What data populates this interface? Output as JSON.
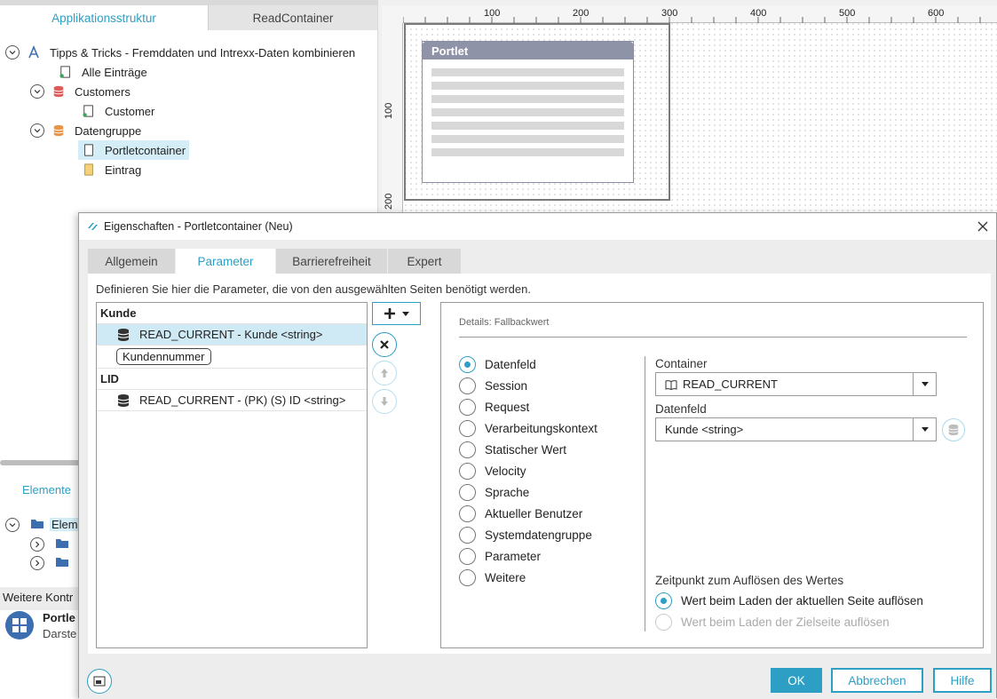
{
  "workspace": {
    "tabs": [
      "Applikationsstruktur",
      "ReadContainer"
    ],
    "tree": [
      {
        "label": "Tipps & Tricks - Fremddaten und Intrexx-Daten kombinieren"
      },
      {
        "label": "Alle Einträge"
      },
      {
        "label": "Customers"
      },
      {
        "label": "Customer"
      },
      {
        "label": "Datengruppe"
      },
      {
        "label": "Portletcontainer"
      },
      {
        "label": "Eintrag"
      }
    ],
    "ruler_top": [
      "100",
      "200",
      "300",
      "400",
      "500",
      "600"
    ],
    "ruler_left": [
      "100",
      "200"
    ],
    "portlet_title": "Portlet",
    "lower": {
      "elements_tab": "Elemente",
      "element_row": "Elem",
      "weitere": "Weitere Kontr",
      "portlet_name": "Portle",
      "portlet_desc": "Darste"
    }
  },
  "dialog": {
    "title": "Eigenschaften - Portletcontainer (Neu)",
    "tabs": [
      "Allgemein",
      "Parameter",
      "Barrierefreiheit",
      "Expert"
    ],
    "description": "Definieren Sie hier die Parameter, die von den ausgewählten Seiten benötigt werden.",
    "params": {
      "group1": "Kunde",
      "item1": "READ_CURRENT - Kunde <string>",
      "pill": "Kundennummer",
      "group2": "LID",
      "item2": "READ_CURRENT - (PK) (S) ID <string>"
    },
    "details": {
      "header": "Details: Fallbackwert",
      "options": [
        "Datenfeld",
        "Session",
        "Request",
        "Verarbeitungskontext",
        "Statischer Wert",
        "Velocity",
        "Sprache",
        "Aktueller Benutzer",
        "Systemdatengruppe",
        "Parameter",
        "Weitere"
      ],
      "selected": "Datenfeld",
      "container_label": "Container",
      "container_value": "READ_CURRENT",
      "datenfeld_label": "Datenfeld",
      "datenfeld_value": "Kunde <string>",
      "zeitpunkt_label": "Zeitpunkt zum Auflösen des Wertes",
      "zeitpunkt_options": [
        "Wert beim Laden der aktuellen Seite auflösen",
        "Wert beim Laden der Zielseite auflösen"
      ]
    },
    "buttons": {
      "ok": "OK",
      "cancel": "Abbrechen",
      "help": "Hilfe"
    },
    "colors": {
      "accent": "#2d9fc4",
      "selection": "#cfeaf5"
    }
  }
}
